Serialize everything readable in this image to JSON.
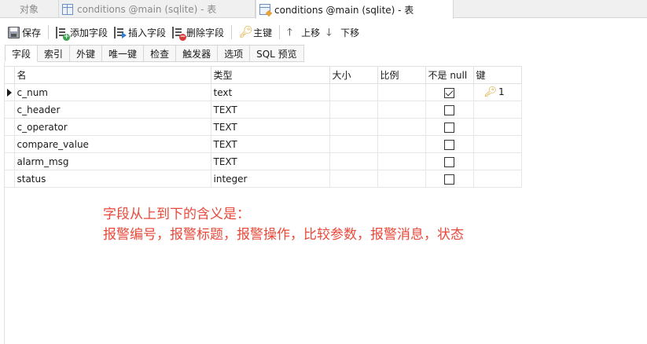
{
  "doc_tabs": {
    "objects_label": "对象",
    "tab1_label": "conditions @main (sqlite) - 表",
    "tab2_label": "conditions @main (sqlite) - 表"
  },
  "toolbar": {
    "save": "保存",
    "add_field": "添加字段",
    "insert_field": "插入字段",
    "delete_field": "删除字段",
    "primary_key": "主键",
    "move_up": "上移",
    "move_down": "下移"
  },
  "sub_tabs": [
    "字段",
    "索引",
    "外键",
    "唯一键",
    "检查",
    "触发器",
    "选项",
    "SQL 预览"
  ],
  "grid": {
    "headers": {
      "name": "名",
      "type": "类型",
      "size": "大小",
      "scale": "比例",
      "not_null": "不是 null",
      "key": "键"
    },
    "rows": [
      {
        "name": "c_num",
        "type": "text",
        "not_null": true,
        "key": "1"
      },
      {
        "name": "c_header",
        "type": "TEXT",
        "not_null": false,
        "key": ""
      },
      {
        "name": "c_operator",
        "type": "TEXT",
        "not_null": false,
        "key": ""
      },
      {
        "name": "compare_value",
        "type": "TEXT",
        "not_null": false,
        "key": ""
      },
      {
        "name": "alarm_msg",
        "type": "TEXT",
        "not_null": false,
        "key": ""
      },
      {
        "name": "status",
        "type": "integer",
        "not_null": false,
        "key": ""
      }
    ]
  },
  "annotation": {
    "line1": "字段从上到下的含义是：",
    "line2": "报警编号，报警标题，报警操作，比较参数，报警消息，状态"
  },
  "colors": {
    "annotation": "#e8493a",
    "key": "#d9a21b"
  },
  "icons": [
    "table-icon",
    "design-table-icon",
    "save-icon",
    "add-field-icon",
    "insert-field-icon",
    "delete-field-icon",
    "key-icon",
    "arrow-up-icon",
    "arrow-down-icon"
  ]
}
